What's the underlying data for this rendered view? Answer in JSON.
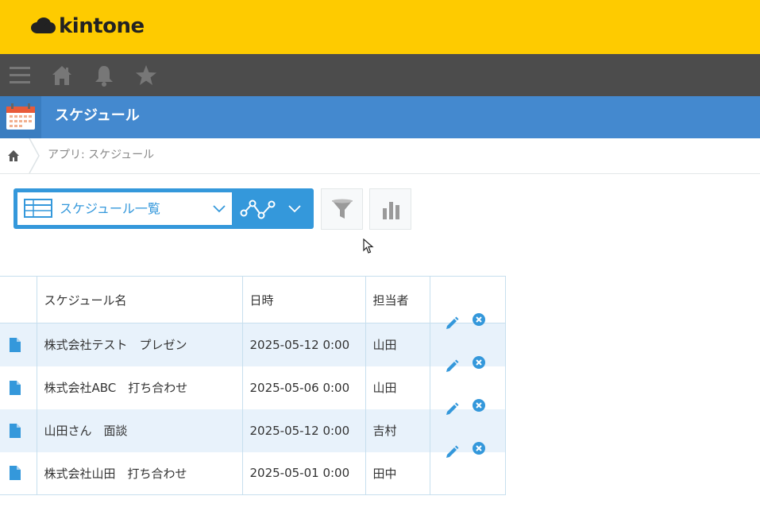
{
  "brand": {
    "name": "kintone"
  },
  "nav": {
    "icons": [
      "menu-icon",
      "home-icon",
      "bell-icon",
      "star-icon"
    ]
  },
  "app": {
    "title": "スケジュール"
  },
  "breadcrumb": {
    "text": "アプリ: スケジュール"
  },
  "toolbar": {
    "view_label": "スケジュール一覧"
  },
  "table": {
    "headers": [
      "スケジュール名",
      "日時",
      "担当者"
    ],
    "rows": [
      {
        "name": "株式会社テスト　プレゼン",
        "datetime": "2025-05-12 0:00",
        "owner": "山田"
      },
      {
        "name": "株式会社ABC　打ち合わせ",
        "datetime": "2025-05-06 0:00",
        "owner": "山田"
      },
      {
        "name": "山田さん　面談",
        "datetime": "2025-05-12 0:00",
        "owner": "吉村"
      },
      {
        "name": "株式会社山田　打ち合わせ",
        "datetime": "2025-05-01 0:00",
        "owner": "田中"
      }
    ]
  },
  "colors": {
    "topbar": "#fecb00",
    "navbar": "#4c4c4c",
    "appbar": "#4489cf",
    "accent": "#3498db",
    "row_alt": "#e8f2fb"
  }
}
